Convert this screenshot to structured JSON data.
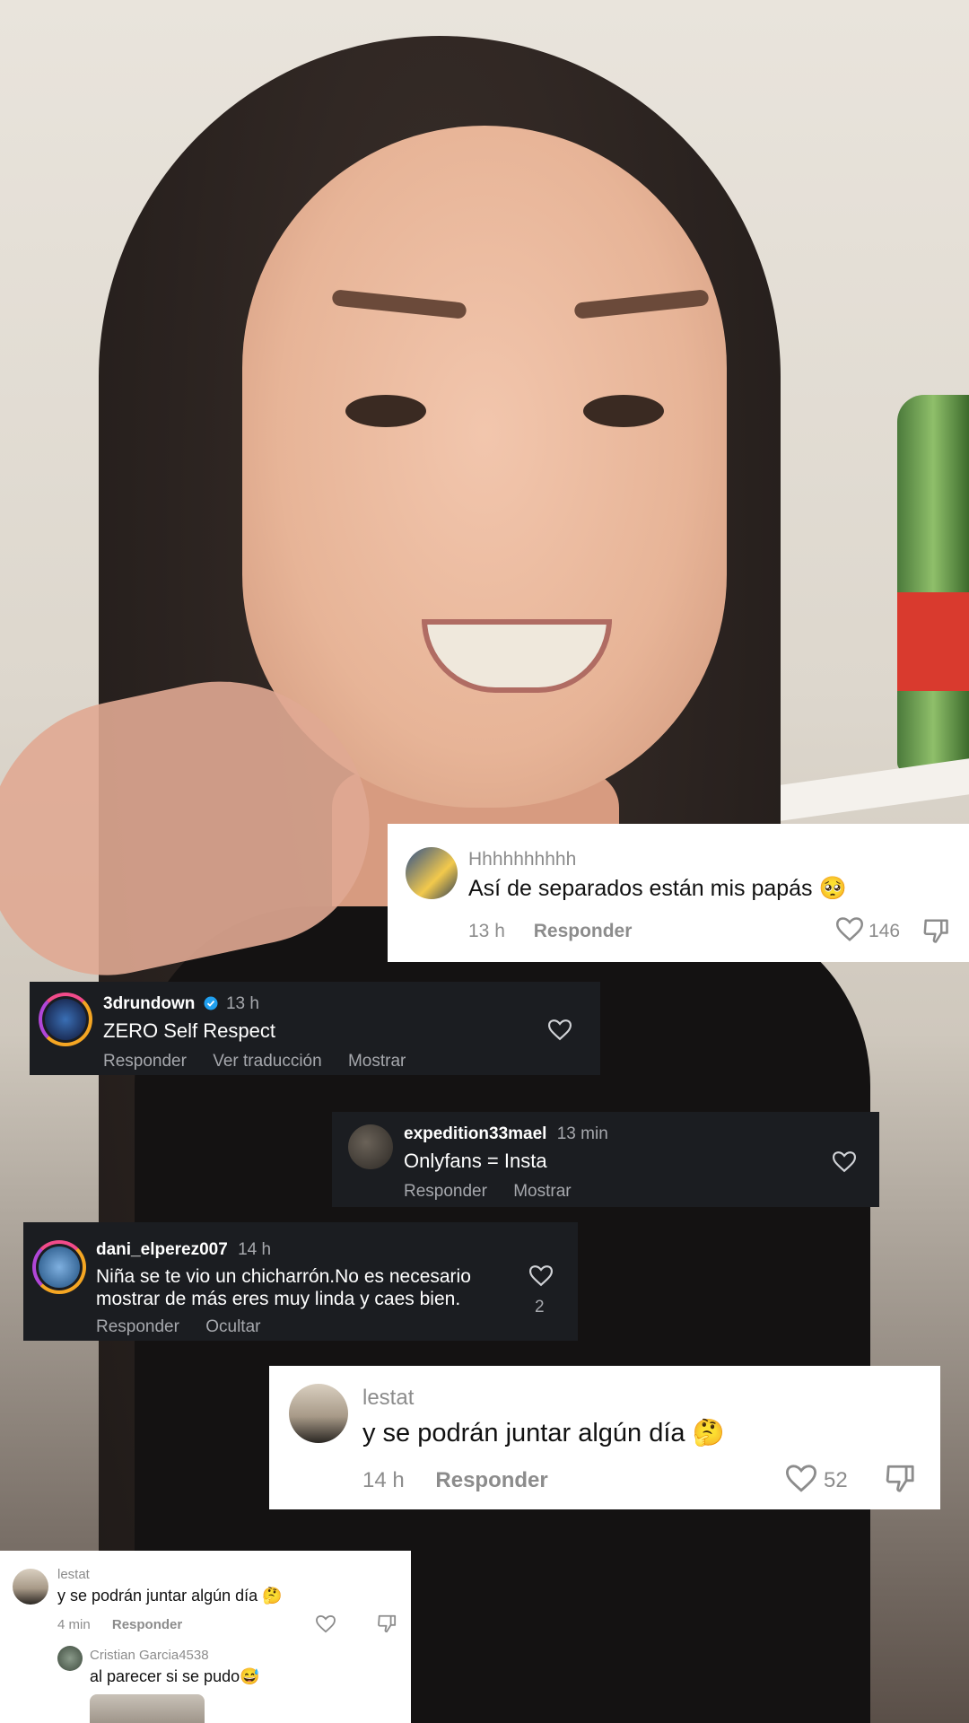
{
  "comments": [
    {
      "username": "Hhhhhhhhhh",
      "text": "Así de separados están mis papás 🥺",
      "time": "13 h",
      "reply_label": "Responder",
      "likes": "146"
    },
    {
      "username": "3drundown",
      "verified": true,
      "time": "13 h",
      "text": "ZERO Self Respect",
      "actions": [
        "Responder",
        "Ver traducción",
        "Mostrar"
      ]
    },
    {
      "username": "expedition33mael",
      "time": "13 min",
      "text": "Onlyfans = Insta",
      "actions": [
        "Responder",
        "Mostrar"
      ]
    },
    {
      "username": "dani_elperez007",
      "time": "14 h",
      "text_line1": "Niña se te vio un chicharrón.No es necesario",
      "text_line2": "mostrar de más eres muy linda y caes bien.",
      "likes": "2",
      "actions": [
        "Responder",
        "Ocultar"
      ]
    },
    {
      "username": "lestat",
      "text": "y se podrán juntar algún día 🤔",
      "time": "14 h",
      "reply_label": "Responder",
      "likes": "52"
    },
    {
      "username": "lestat",
      "text": "y se podrán juntar algún día 🤔",
      "time": "4 min",
      "reply_label": "Responder",
      "reply": {
        "username": "Cristian Garcia4538",
        "text": "al parecer si se pudo😅"
      }
    }
  ],
  "colors": {
    "light_card": "#ffffff",
    "dark_card": "#1b1d21",
    "verified": "#20a0f0",
    "ring_pink": "#f24b8a",
    "ring_orange": "#f5a623"
  },
  "icons": [
    "heart-icon",
    "dislike-icon",
    "verified-badge-icon"
  ]
}
